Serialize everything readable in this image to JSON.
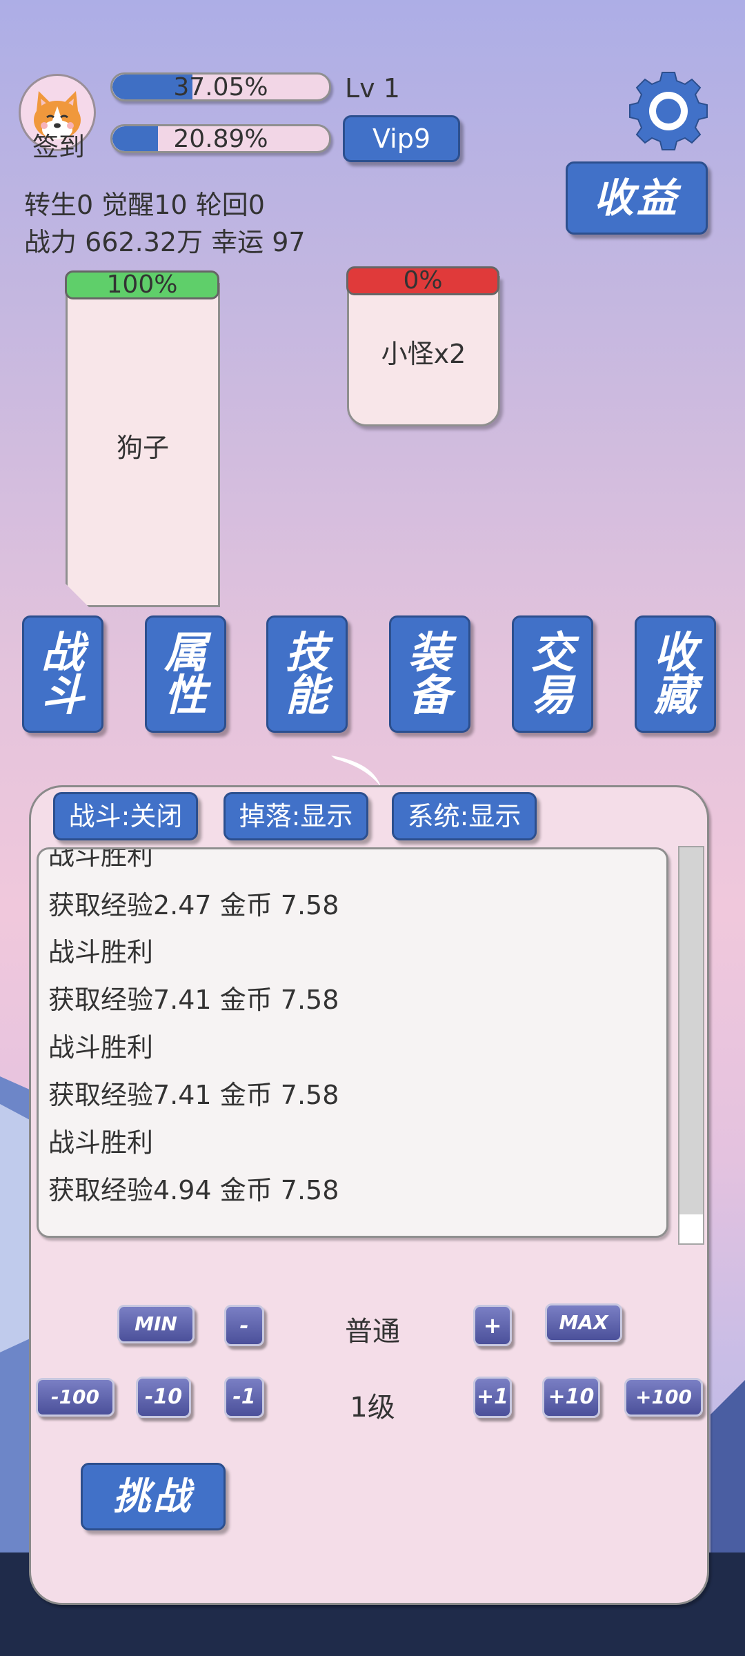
{
  "header": {
    "checkin_label": "签到",
    "exp_bar": {
      "text": "37.05%",
      "progress": 0.3705
    },
    "second_bar": {
      "text": "20.89%",
      "progress": 0.2089
    },
    "level": "Lv 1",
    "vip": "Vip9",
    "income": "收益",
    "stats_line1": "转生0 觉醒10 轮回0",
    "stats_line2": "战力 662.32万  幸运 97"
  },
  "player_card": {
    "hp": "100%",
    "hp_progress": 1.0,
    "hp_color": "#5fcf6a",
    "name": "狗子"
  },
  "enemy_card": {
    "hp": "0%",
    "hp_progress": 0.0,
    "hp_color": "#e03a3a",
    "name": "小怪x2"
  },
  "tabs": [
    {
      "label_top": "战",
      "label_bottom": "斗"
    },
    {
      "label_top": "属",
      "label_bottom": "性"
    },
    {
      "label_top": "技",
      "label_bottom": "能"
    },
    {
      "label_top": "装",
      "label_bottom": "备"
    },
    {
      "label_top": "交",
      "label_bottom": "易"
    },
    {
      "label_top": "收",
      "label_bottom": "藏"
    }
  ],
  "filters": {
    "battle": "战斗:关闭",
    "drop": "掉落:显示",
    "system": "系统:显示"
  },
  "log": {
    "partial_line": "战斗胜利",
    "lines": [
      "获取经验2.47 金币 7.58",
      "战斗胜利",
      "获取经验7.41 金币 7.58",
      "战斗胜利",
      "获取经验7.41 金币 7.58",
      "战斗胜利",
      "获取经验4.94 金币 7.58"
    ]
  },
  "difficulty": {
    "min": "MIN",
    "minus": "-",
    "value": "普通",
    "plus": "+",
    "max": "MAX"
  },
  "stage": {
    "m100": "-100",
    "m10": "-10",
    "m1": "-1",
    "value": "1级",
    "p1": "+1",
    "p10": "+10",
    "p100": "+100"
  },
  "challenge": "挑战",
  "colors": {
    "accent": "#4171c8",
    "panel": "#f4dde8"
  },
  "icons": {
    "avatar": "corgi-avatar-icon",
    "settings": "gear-icon"
  }
}
